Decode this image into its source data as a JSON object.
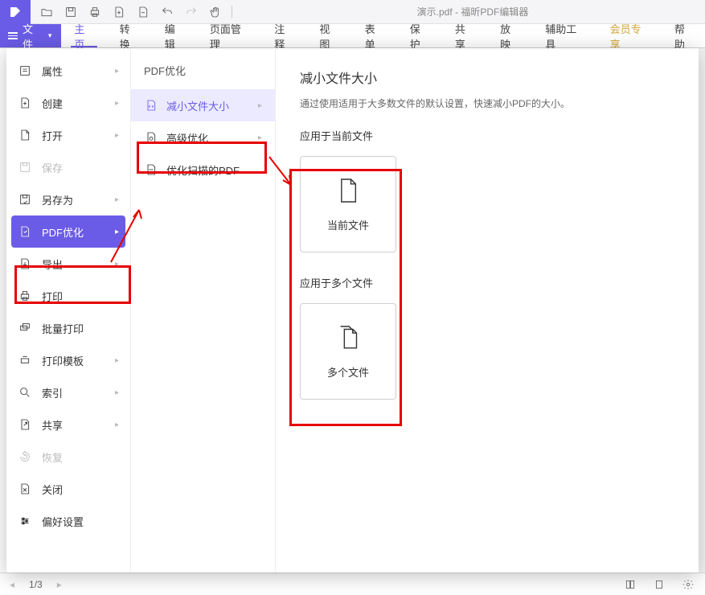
{
  "title": "演示.pdf - 福昕PDF编辑器",
  "ribbon": {
    "file": "文件",
    "tabs": [
      "主页",
      "转换",
      "编辑",
      "页面管理",
      "注释",
      "视图",
      "表单",
      "保护",
      "共享",
      "放映",
      "辅助工具",
      "会员专享",
      "帮助"
    ]
  },
  "fileMenu": {
    "items": [
      {
        "label": "属性",
        "arrow": true
      },
      {
        "label": "创建",
        "arrow": true
      },
      {
        "label": "打开",
        "arrow": true
      },
      {
        "label": "保存",
        "arrow": false,
        "disabled": true
      },
      {
        "label": "另存为",
        "arrow": true
      },
      {
        "label": "PDF优化",
        "arrow": true,
        "active": true
      },
      {
        "label": "导出",
        "arrow": true
      },
      {
        "label": "打印",
        "arrow": false
      },
      {
        "label": "批量打印",
        "arrow": false
      },
      {
        "label": "打印模板",
        "arrow": true
      },
      {
        "label": "索引",
        "arrow": true
      },
      {
        "label": "共享",
        "arrow": true
      },
      {
        "label": "恢复",
        "arrow": false,
        "disabled": true
      },
      {
        "label": "关闭",
        "arrow": false
      },
      {
        "label": "偏好设置",
        "arrow": false
      }
    ]
  },
  "subPanel": {
    "title": "PDF优化",
    "items": [
      {
        "label": "减小文件大小",
        "active": true
      },
      {
        "label": "高级优化"
      },
      {
        "label": "优化扫描的PDF"
      }
    ]
  },
  "detail": {
    "heading": "减小文件大小",
    "desc": "通过使用适用于大多数文件的默认设置，快速减小PDF的大小。",
    "section1": "应用于当前文件",
    "card1": "当前文件",
    "section2": "应用于多个文件",
    "card2": "多个文件"
  },
  "status": {
    "page": "1/3"
  }
}
